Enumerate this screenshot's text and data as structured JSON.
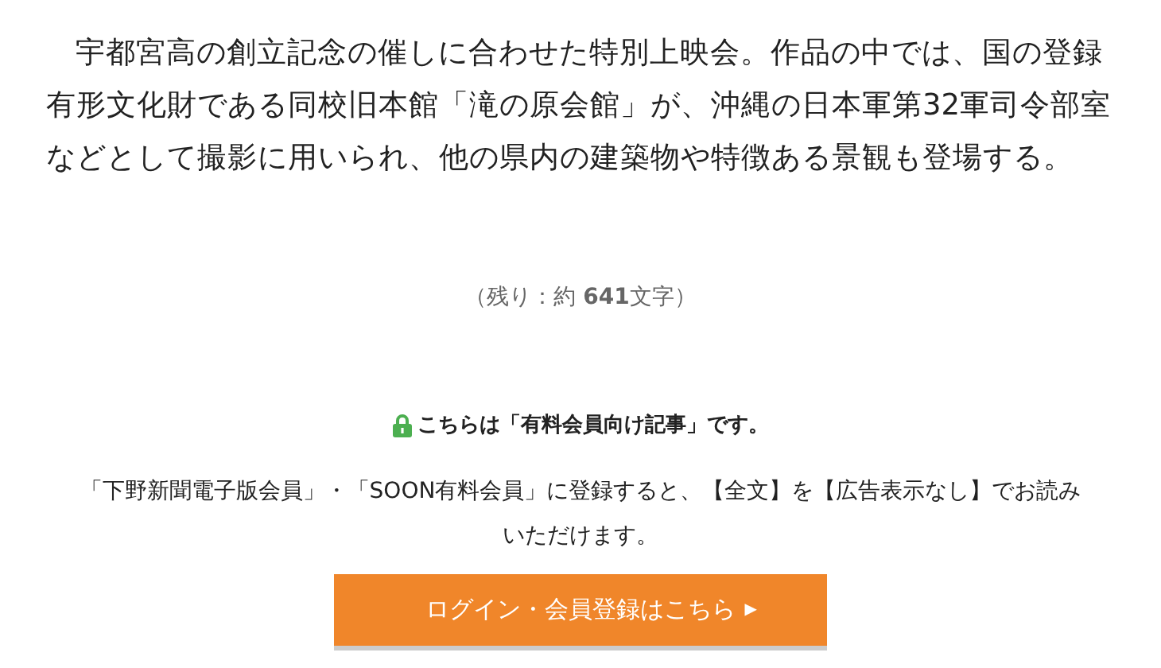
{
  "article": {
    "paragraph": "宇都宮高の創立記念の催しに合わせた特別上映会。作品の中では、国の登録有形文化財である同校旧本館「滝の原会館」が、沖縄の日本軍第32軍司令部室などとして撮影に用いられ、他の県内の建築物や特徴ある景観も登場する。",
    "remaining": "（残り：約 **641**文字）"
  },
  "paywall": {
    "notice": "こちらは「有料会員向け記事」です。",
    "description": "「下野新聞電子版会員」・「SOON有料会員」に登録すると、【全文】を【広告表示なし】でお読みいただけます。",
    "button": {
      "label": "ログイン・会員登録はこちら",
      "arrow": "▶"
    }
  }
}
